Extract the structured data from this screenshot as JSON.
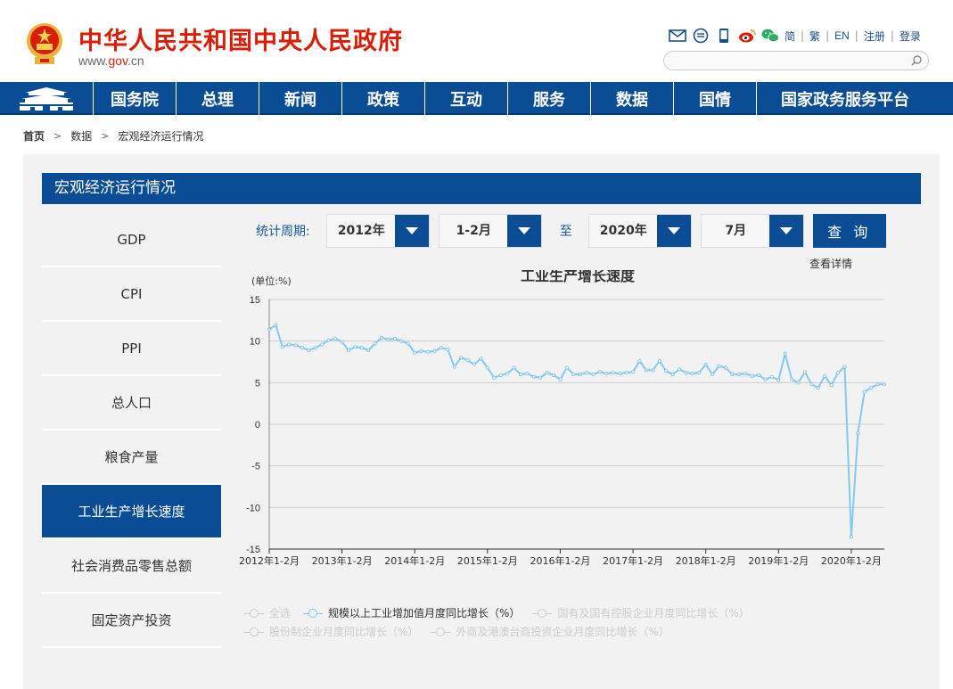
{
  "header": {
    "title": "中华人民共和国中央人民政府",
    "url_prefix": "www.",
    "url_domain": "gov",
    "url_suffix": ".cn",
    "links": [
      "简",
      "繁",
      "EN",
      "注册",
      "登录"
    ],
    "search_placeholder": ""
  },
  "nav": {
    "items": [
      "国务院",
      "总理",
      "新闻",
      "政策",
      "互动",
      "服务",
      "数据",
      "国情",
      "国家政务服务平台"
    ]
  },
  "breadcrumb": [
    "首页",
    "数据",
    "宏观经济运行情况"
  ],
  "panel": {
    "title": "宏观经济运行情况",
    "sidebar": [
      "GDP",
      "CPI",
      "PPI",
      "总人口",
      "粮食产量",
      "工业生产增长速度",
      "社会消费品零售总额",
      "固定资产投资"
    ],
    "active_index": 5
  },
  "filters": {
    "label": "统计周期:",
    "start_year": "2012年",
    "start_month": "1-2月",
    "to": "至",
    "end_year": "2020年",
    "end_month": "7月",
    "query": "查 询"
  },
  "details_link": "查看详情",
  "colors": {
    "brand_blue": "#0b4d95",
    "brand_red": "#d81e06",
    "series": "#86c8ef"
  },
  "legend": [
    {
      "label": "全选",
      "on": false
    },
    {
      "label": "规模以上工业增加值月度同比增长（%）",
      "on": true
    },
    {
      "label": "国有及国有控股企业月度同比增长（%）",
      "on": false
    },
    {
      "label": "股份制企业月度同比增长（%）",
      "on": false
    },
    {
      "label": "外商及港澳台商投资企业月度同比增长（%）",
      "on": false
    }
  ],
  "chart_data": {
    "type": "line",
    "title": "工业生产增长速度",
    "ylabel": "(单位:%)",
    "ylim": [
      -15,
      15
    ],
    "yticks": [
      15,
      10,
      5,
      0,
      -5,
      -10,
      -15
    ],
    "xtick_labels": [
      "2012年1-2月",
      "2013年1-2月",
      "2014年1-2月",
      "2015年1-2月",
      "2016年1-2月",
      "2017年1-2月",
      "2018年1-2月",
      "2019年1-2月",
      "2020年1-2月"
    ],
    "grid": true,
    "series": [
      {
        "name": "规模以上工业增加值月度同比增长（%）",
        "periods_per_year": 11,
        "values": [
          11.4,
          11.9,
          9.3,
          9.6,
          9.5,
          9.2,
          8.9,
          9.2,
          9.6,
          10.1,
          10.3,
          9.9,
          8.9,
          9.3,
          9.2,
          8.9,
          9.7,
          10.4,
          10.2,
          10.3,
          10.0,
          9.7,
          8.6,
          8.8,
          8.7,
          8.8,
          9.2,
          9.0,
          6.9,
          8.0,
          7.7,
          7.2,
          7.9,
          6.8,
          5.6,
          5.9,
          6.1,
          6.8,
          6.0,
          6.1,
          5.7,
          5.6,
          6.2,
          5.9,
          5.4,
          6.8,
          6.0,
          6.0,
          6.2,
          6.0,
          6.3,
          6.1,
          6.2,
          6.1,
          6.2,
          6.3,
          7.6,
          6.5,
          6.5,
          7.6,
          6.4,
          6.0,
          6.6,
          6.2,
          6.1,
          6.2,
          7.2,
          6.0,
          7.0,
          6.8,
          6.0,
          6.0,
          6.1,
          5.8,
          5.9,
          5.4,
          5.7,
          5.3,
          8.5,
          5.4,
          5.0,
          6.3,
          4.8,
          4.4,
          5.8,
          4.7,
          6.2,
          6.9,
          -13.5,
          -1.1,
          3.9,
          4.4,
          4.8,
          4.8
        ]
      }
    ]
  }
}
